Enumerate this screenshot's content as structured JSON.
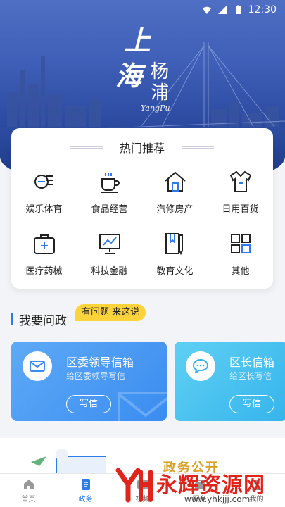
{
  "status_bar": {
    "time": "12:30"
  },
  "hero": {
    "logo_chars": [
      "上",
      "海",
      "杨",
      "浦"
    ],
    "logo_en": "YangPu"
  },
  "recommend": {
    "title": "热门推荐",
    "items": [
      {
        "label": "娱乐体育",
        "icon": "entertainment-icon"
      },
      {
        "label": "食品经营",
        "icon": "coffee-cup-icon"
      },
      {
        "label": "汽修房产",
        "icon": "house-icon"
      },
      {
        "label": "日用百货",
        "icon": "shirt-icon"
      },
      {
        "label": "医疗药械",
        "icon": "medical-kit-icon"
      },
      {
        "label": "科技金融",
        "icon": "monitor-chart-icon"
      },
      {
        "label": "教育文化",
        "icon": "book-pencil-icon"
      },
      {
        "label": "其他",
        "icon": "grid-icon"
      }
    ]
  },
  "ask": {
    "title": "我要问政",
    "badge": "有问题 来这说"
  },
  "mailboxes": [
    {
      "title": "区委领导信箱",
      "subtitle": "给区委领导写信",
      "button": "写信",
      "icon": "mail-icon"
    },
    {
      "title": "区长信箱",
      "subtitle": "给区长写信",
      "button": "写信",
      "icon": "chat-icon"
    }
  ],
  "banner": {
    "title": "政务公开"
  },
  "tabs": [
    {
      "label": "首页",
      "icon": "home-icon",
      "active": false
    },
    {
      "label": "政务",
      "icon": "document-icon",
      "active": true
    },
    {
      "label": "视频",
      "icon": "play-icon",
      "active": false
    },
    {
      "label": "服务",
      "icon": "service-icon",
      "active": false
    },
    {
      "label": "我的",
      "icon": "user-icon",
      "active": false
    }
  ],
  "watermark": {
    "text": "永辉资源网",
    "url": "www.yhkjjj.com"
  },
  "colors": {
    "accent": "#2d7be8",
    "badge": "#fcd33b",
    "mail_left": "#3a8cf0",
    "mail_right": "#36b4ec",
    "hero": "#3f5fb8"
  }
}
